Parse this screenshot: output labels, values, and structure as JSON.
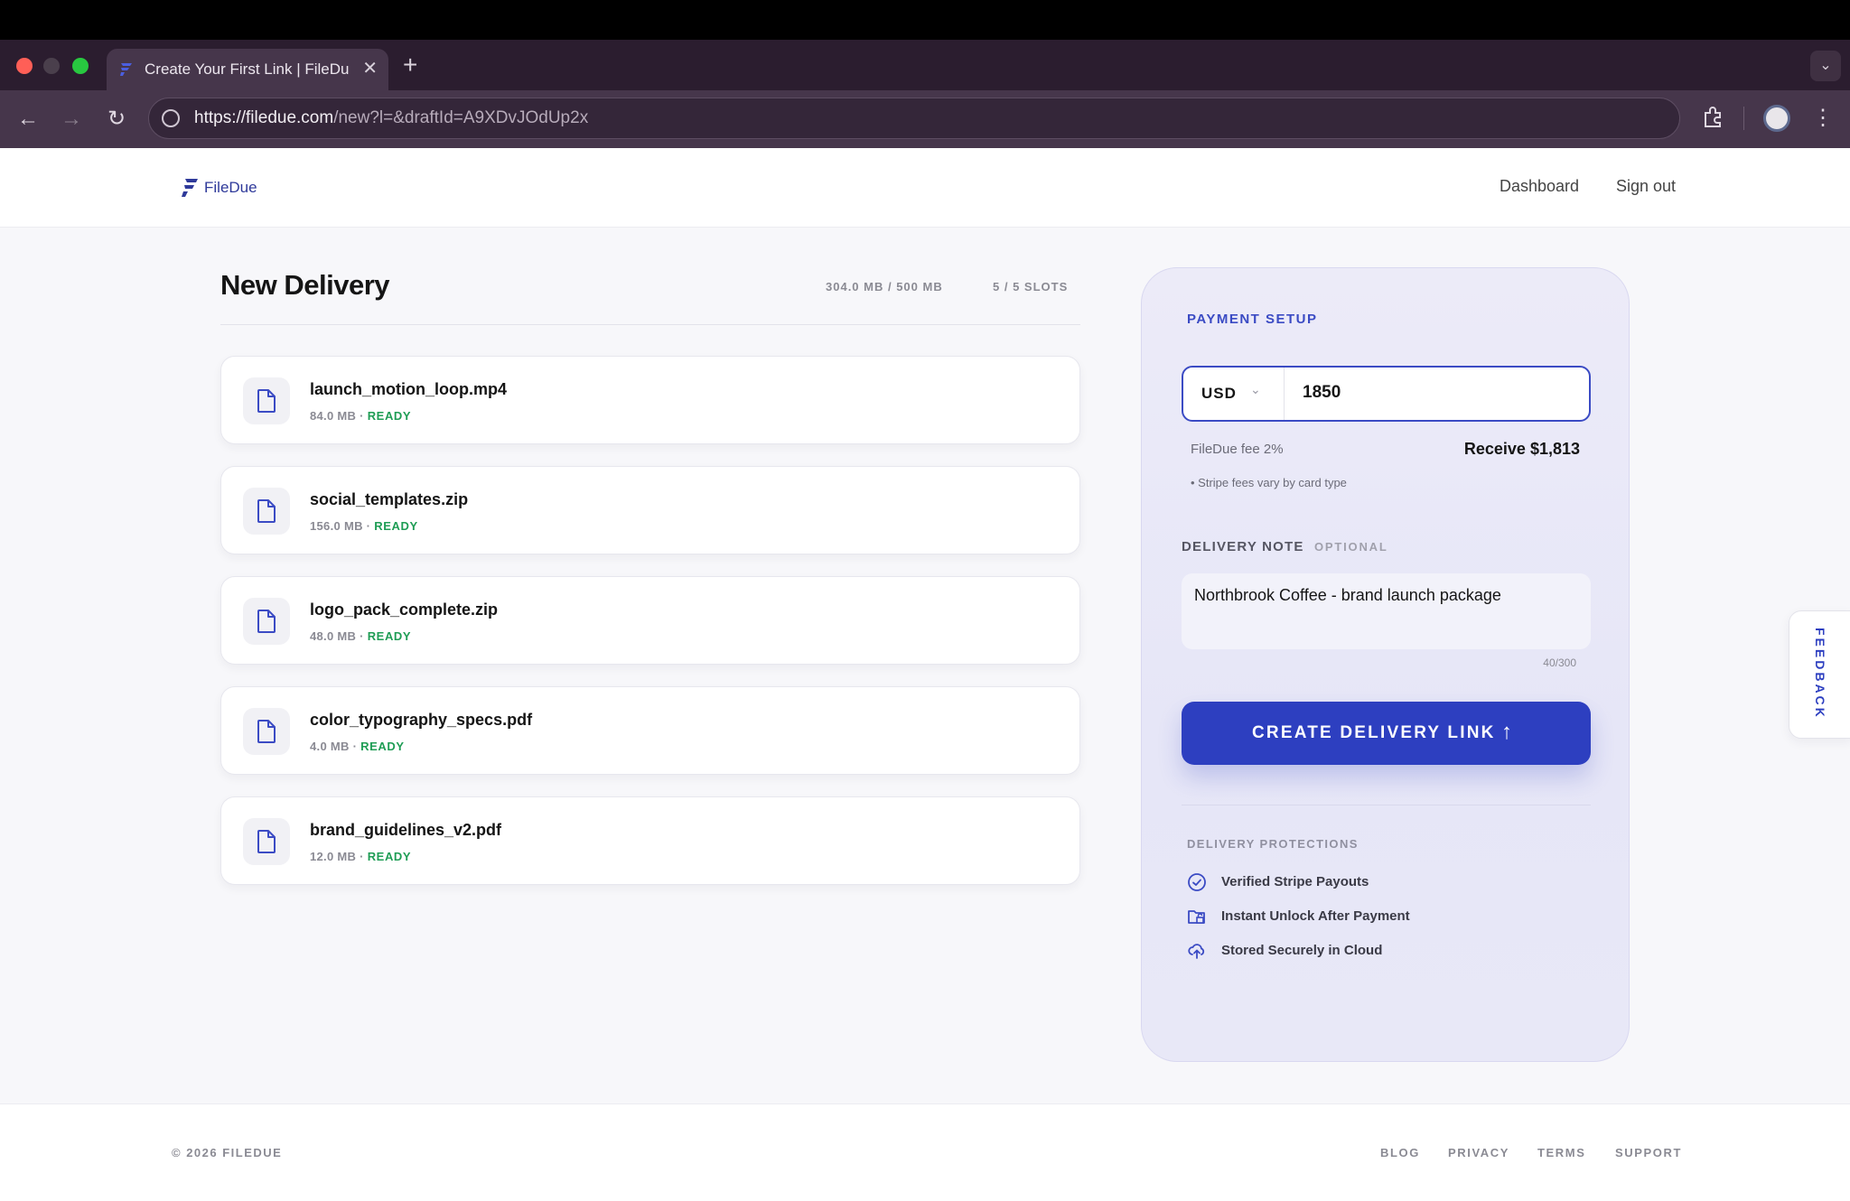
{
  "browser": {
    "tab_title": "Create Your First Link | FileDue",
    "url_host": "https://filedue.com",
    "url_path": "/new?l=&draftId=A9XDvJOdUp2x"
  },
  "header": {
    "brand": "FileDue",
    "nav": [
      "Dashboard",
      "Sign out"
    ]
  },
  "delivery": {
    "title": "New Delivery",
    "storage": "304.0 MB / 500 MB",
    "slots": "5 / 5 SLOTS",
    "files": [
      {
        "name": "launch_motion_loop.mp4",
        "size": "84.0 MB",
        "status": "READY"
      },
      {
        "name": "social_templates.zip",
        "size": "156.0 MB",
        "status": "READY"
      },
      {
        "name": "logo_pack_complete.zip",
        "size": "48.0 MB",
        "status": "READY"
      },
      {
        "name": "color_typography_specs.pdf",
        "size": "4.0 MB",
        "status": "READY"
      },
      {
        "name": "brand_guidelines_v2.pdf",
        "size": "12.0 MB",
        "status": "READY"
      }
    ]
  },
  "payment": {
    "label": "PAYMENT SETUP",
    "currency": "USD",
    "amount": "1850",
    "fee": "FileDue fee 2%",
    "receive": "Receive $1,813",
    "stripe_note": "• Stripe fees vary by card type"
  },
  "note": {
    "label": "DELIVERY NOTE",
    "optional": "OPTIONAL",
    "value": "Northbrook Coffee - brand launch package",
    "count": "40/300"
  },
  "cta": {
    "label": "CREATE DELIVERY LINK",
    "icon": "arrow-up-icon"
  },
  "protections": {
    "label": "DELIVERY PROTECTIONS",
    "items": [
      {
        "text": "Verified Stripe Payouts",
        "icon": "check-circle-icon"
      },
      {
        "text": "Instant Unlock After Payment",
        "icon": "unlock-folder-icon"
      },
      {
        "text": "Stored Securely in Cloud",
        "icon": "cloud-upload-icon"
      }
    ]
  },
  "feedback": "FEEDBACK",
  "footer": {
    "copyright": "© 2026 FILEDUE",
    "links": [
      "BLOG",
      "PRIVACY",
      "TERMS",
      "SUPPORT"
    ]
  },
  "colors": {
    "accent": "#2d3fc0",
    "ready": "#1f9d55",
    "panel": "#e9e8f8"
  }
}
